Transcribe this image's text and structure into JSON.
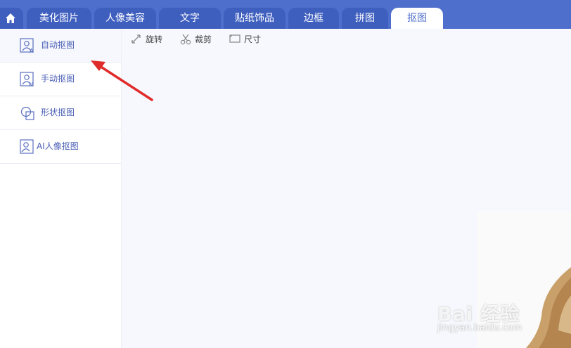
{
  "tabs": [
    {
      "label": "美化图片"
    },
    {
      "label": "人像美容"
    },
    {
      "label": "文字"
    },
    {
      "label": "贴纸饰品"
    },
    {
      "label": "边框"
    },
    {
      "label": "拼图"
    },
    {
      "label": "抠图",
      "active": true
    }
  ],
  "sidebar": {
    "items": [
      {
        "label": "自动抠图",
        "icon": "auto-cutout-icon",
        "active": true
      },
      {
        "label": "手动抠图",
        "icon": "manual-cutout-icon"
      },
      {
        "label": "形状抠图",
        "icon": "shape-cutout-icon"
      },
      {
        "label": "AI人像抠图",
        "icon": "ai-portrait-cutout-icon"
      }
    ]
  },
  "toolbar": {
    "rotate_label": "旋转",
    "crop_label": "裁剪",
    "size_label": "尺寸"
  },
  "watermark": {
    "text": "Bai 经验",
    "url": "jingyan.baidu.com"
  },
  "colors": {
    "topbar": "#4f6fcd",
    "tab": "#3f5fbf",
    "accent": "#4a5fb5",
    "annotation_arrow": "#e02b2b"
  }
}
